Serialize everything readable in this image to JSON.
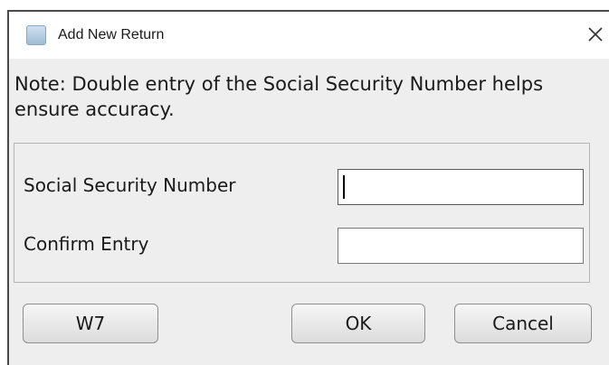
{
  "window": {
    "title": "Add New Return",
    "close_symbol": "×"
  },
  "note": {
    "text": "Note: Double entry of the Social Security Number helps ensure accuracy."
  },
  "fields": {
    "ssn": {
      "label": "Social Security Number",
      "value": "",
      "placeholder": ""
    },
    "confirm": {
      "label": "Confirm Entry",
      "value": "",
      "placeholder": ""
    }
  },
  "buttons": {
    "w7": "W7",
    "ok": "OK",
    "cancel": "Cancel"
  },
  "icons": {
    "app": "app-window-icon",
    "close": "close-icon"
  },
  "colors": {
    "dialog_bg": "#eeeeee",
    "titlebar_bg": "#ffffff",
    "border": "#4a4a4a"
  }
}
